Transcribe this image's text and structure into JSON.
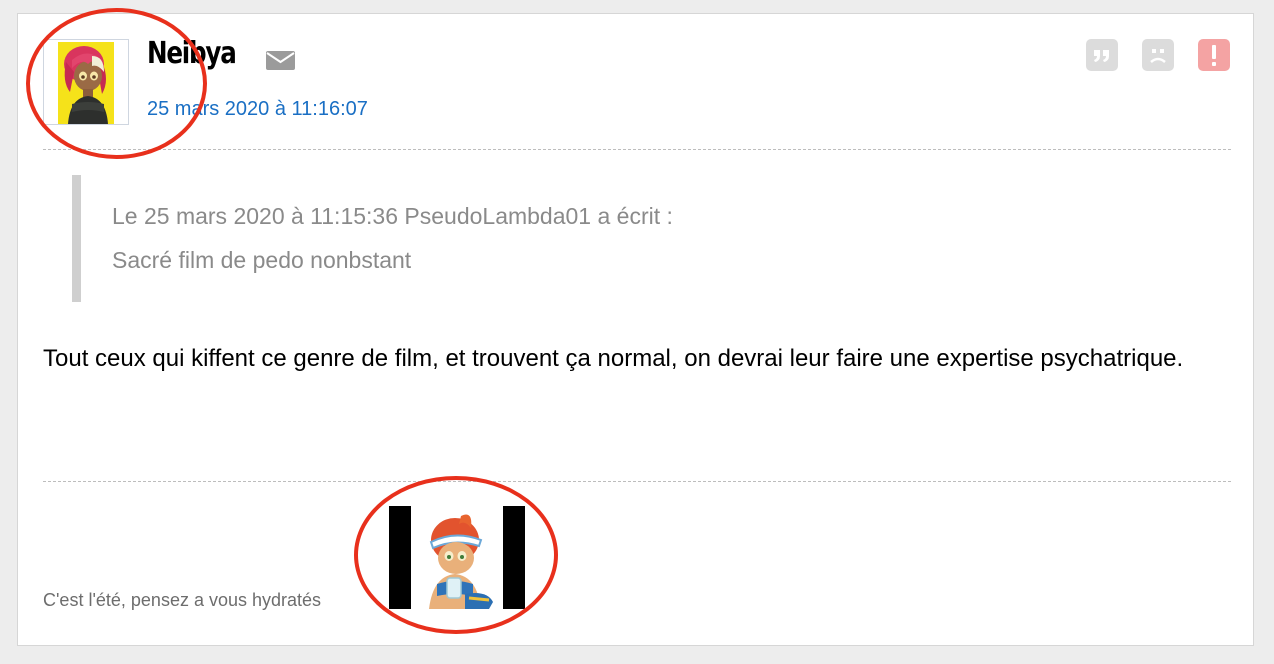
{
  "post": {
    "username": "Neibya",
    "date": "25 mars 2020 à 11:16:07",
    "quote": {
      "header": "Le 25 mars 2020 à 11:15:36 PseudoLambda01 a écrit :",
      "text": "Sacré film de pedo nonbstant"
    },
    "message": "Tout ceux qui kiffent ce genre de film, et trouvent ça normal, on devrai leur faire une expertise psychatrique.",
    "signature": "C'est l'été, pensez a vous hydratés"
  },
  "icons": {
    "mail": "envelope-icon",
    "quote_action": "quote-icon",
    "sad_action": "sad-face-icon",
    "report_action": "exclamation-icon"
  },
  "colors": {
    "date_link": "#1a6fc4",
    "action_gray": "#d9d9d9",
    "report_red": "#f4a3a3",
    "annotation_red": "#e8301c"
  }
}
